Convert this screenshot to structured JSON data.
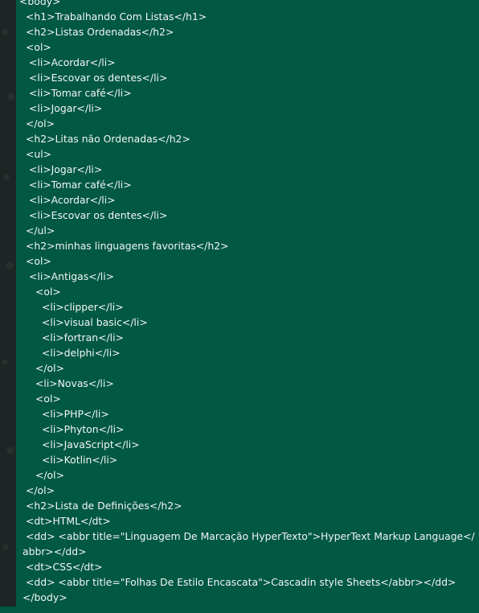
{
  "lines": [
    {
      "indent": 4,
      "text": "<body>"
    },
    {
      "indent": 12,
      "text": "<h1>Trabalhando Com Listas</h1>"
    },
    {
      "indent": 12,
      "text": "<h2>Listas Ordenadas</h2>"
    },
    {
      "indent": 12,
      "text": "<ol>"
    },
    {
      "indent": 16,
      "text": "<li>Acordar</li>"
    },
    {
      "indent": 16,
      "text": "<li>Escovar os dentes</li>"
    },
    {
      "indent": 16,
      "text": "<li>Tomar café</li>"
    },
    {
      "indent": 16,
      "text": "<li>Jogar</li>"
    },
    {
      "indent": 12,
      "text": "</ol>"
    },
    {
      "indent": 12,
      "text": "<h2>Litas não Ordenadas</h2>"
    },
    {
      "indent": 12,
      "text": "<ul>"
    },
    {
      "indent": 16,
      "text": "<li>Jogar</li>"
    },
    {
      "indent": 16,
      "text": "<li>Tomar café</li>"
    },
    {
      "indent": 16,
      "text": "<li>Acordar</li>"
    },
    {
      "indent": 16,
      "text": "<li>Escovar os dentes</li>"
    },
    {
      "indent": 12,
      "text": "</ul>"
    },
    {
      "indent": 12,
      "text": "<h2>minhas linguagens favoritas</h2>"
    },
    {
      "indent": 12,
      "text": "<ol>"
    },
    {
      "indent": 16,
      "text": "<li>Antigas</li>"
    },
    {
      "indent": 24,
      "text": "<ol>"
    },
    {
      "indent": 32,
      "text": "<li>clipper</li>"
    },
    {
      "indent": 32,
      "text": "<li>visual basic</li>"
    },
    {
      "indent": 32,
      "text": "<li>fortran</li>"
    },
    {
      "indent": 32,
      "text": "<li>delphi</li>"
    },
    {
      "indent": 24,
      "text": "</ol>"
    },
    {
      "indent": 24,
      "text": "<li>Novas</li>"
    },
    {
      "indent": 24,
      "text": "<ol>"
    },
    {
      "indent": 32,
      "text": "<li>PHP</li>"
    },
    {
      "indent": 32,
      "text": "<li>Phyton</li>"
    },
    {
      "indent": 32,
      "text": "<li>JavaScript</li>"
    },
    {
      "indent": 32,
      "text": "<li>Kotlin</li>"
    },
    {
      "indent": 24,
      "text": "</ol>"
    },
    {
      "indent": 12,
      "text": "</ol>"
    },
    {
      "indent": 12,
      "text": "<h2>Lista de Definições</h2>"
    },
    {
      "indent": 12,
      "text": "<dt>HTML</dt>"
    },
    {
      "indent": 12,
      "text": "<dd> <abbr title=\"Linguagem De Marcação HyperTexto\">HyperText Markup Language</"
    },
    {
      "indent": 8,
      "text": "abbr></dd>"
    },
    {
      "indent": 12,
      "text": "<dt>CSS</dt>"
    },
    {
      "indent": 12,
      "text": "<dd> <abbr title=\"Folhas De Estilo Encascata\">Cascadin style Sheets</abbr></dd>"
    },
    {
      "indent": 8,
      "text": "</body>"
    }
  ]
}
